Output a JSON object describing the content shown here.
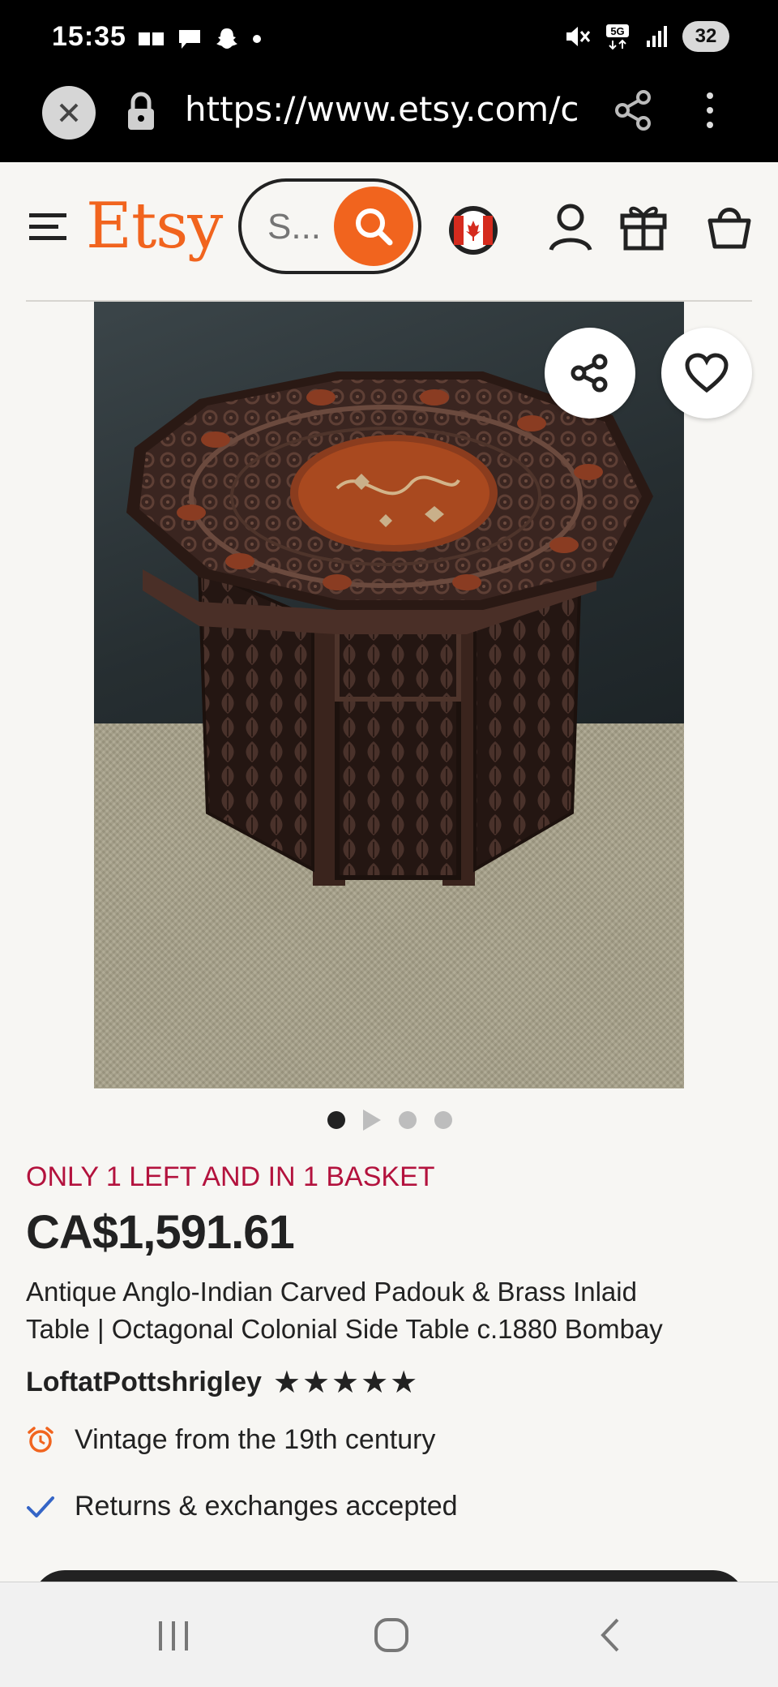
{
  "status_bar": {
    "time": "15:35",
    "battery": "32"
  },
  "browser": {
    "url": "https://www.etsy.com/ca/"
  },
  "header": {
    "logo": "Etsy",
    "search_placeholder": "S...",
    "icons": [
      "menu-icon",
      "search-icon",
      "canada-flag-icon",
      "account-icon",
      "gift-icon",
      "cart-icon"
    ]
  },
  "carousel": {
    "total": 4,
    "active_index": 0,
    "colors": {
      "active": "#222222",
      "inactive": "#bdbdbd"
    }
  },
  "product": {
    "stock_note": "ONLY 1 LEFT AND IN 1 BASKET",
    "price": "CA$1,591.61",
    "title_line1": "Antique Anglo-Indian Carved Padouk & Brass Inlaid",
    "title_line2": "Table | Octagonal Colonial Side Table c.1880 Bombay",
    "shop_name": "LoftatPottshrigley",
    "rating_stars": "★★★★★",
    "rating": 5,
    "features": [
      {
        "icon": "alarm-clock-icon",
        "text": "Vintage from the 19th century"
      },
      {
        "icon": "checkmark-icon",
        "text": "Returns & exchanges accepted"
      }
    ]
  },
  "colors": {
    "brand": "#f1641e",
    "stock_note": "#b3123d",
    "text": "#222222",
    "background": "#f7f6f3"
  }
}
